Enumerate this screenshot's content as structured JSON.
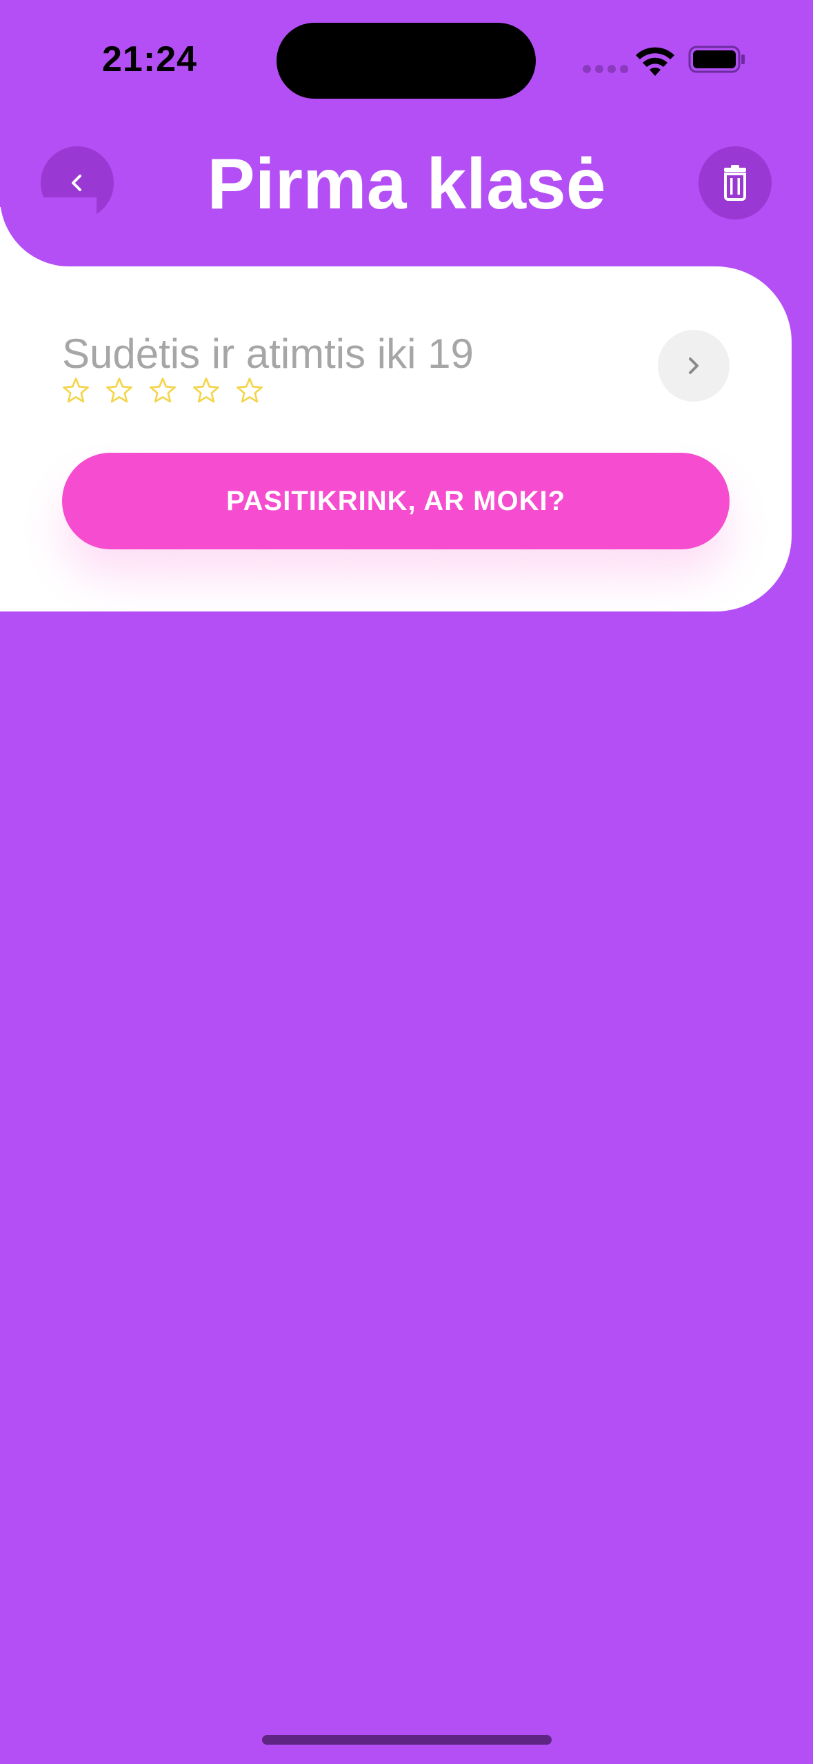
{
  "status_bar": {
    "time": "21:24",
    "icons": [
      "cellular-signal-icon",
      "wifi-icon",
      "battery-icon"
    ]
  },
  "header": {
    "title": "Pirma klasė",
    "back_icon": "chevron-left-icon",
    "delete_icon": "trash-icon"
  },
  "lesson": {
    "title": "Sudėtis ir atimtis iki 19",
    "rating": {
      "filled": 0,
      "total": 5
    },
    "open_icon": "chevron-right-icon",
    "quiz_button_label": "PASITIKRINK, AR MOKI?"
  },
  "colors": {
    "background": "#b44ff5",
    "header_button": "#9a38d3",
    "card": "#ffffff",
    "quiz_button": "#f64ccf",
    "star_outline": "#f4d44a",
    "lesson_text": "#a6a6a6"
  }
}
